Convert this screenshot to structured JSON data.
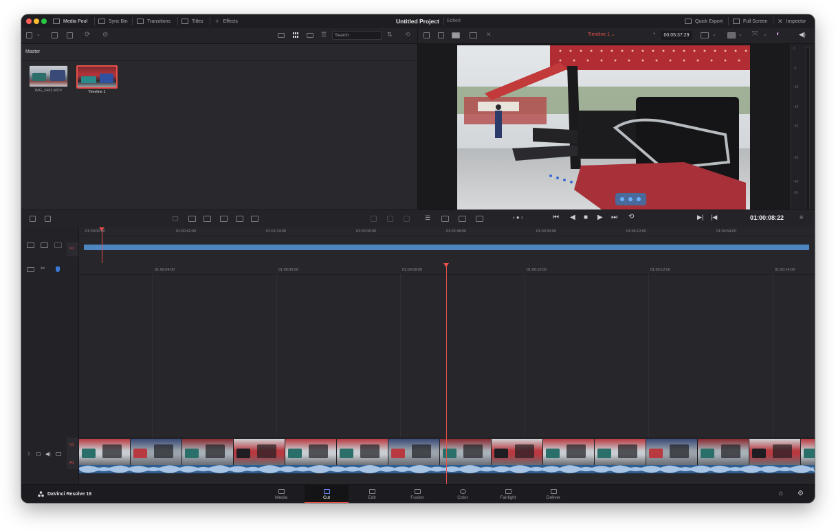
{
  "titlebar": {
    "tabs": [
      {
        "label": "Media Pool",
        "icon": "media-pool-icon"
      },
      {
        "label": "Sync Bin",
        "icon": "sync-bin-icon"
      },
      {
        "label": "Transitions",
        "icon": "transitions-icon"
      },
      {
        "label": "Titles",
        "icon": "titles-icon"
      },
      {
        "label": "Effects",
        "icon": "effects-icon"
      }
    ],
    "project_title": "Untitled Project",
    "project_status": "Edited",
    "right_items": [
      {
        "label": "Quick Export",
        "icon": "quick-export-icon"
      },
      {
        "label": "Full Screen",
        "icon": "full-screen-icon"
      },
      {
        "label": "Inspector",
        "icon": "inspector-icon"
      }
    ]
  },
  "toolbar": {
    "search_placeholder": "Search",
    "timeline_name": "Timeline 1",
    "timeline_duration": "00:05:37:29"
  },
  "media_pool": {
    "bin_name": "Master",
    "items": [
      {
        "name": "IMG_3462.MOV",
        "selected": false
      },
      {
        "name": "Timeline 1",
        "selected": true
      }
    ]
  },
  "viewer": {
    "timecode": "01:00:08:22",
    "meter_labels": [
      "0",
      "-5",
      "-10",
      "-15",
      "-20",
      "-30",
      "-40",
      "-50"
    ]
  },
  "upper_timeline": {
    "track_label": "V1",
    "ruler_labels": [
      "01:00:00:00",
      "01:00:42:00",
      "01:01:24:00",
      "01:02:06:00",
      "01:02:48:00",
      "01:03:30:00",
      "01:04:12:00",
      "01:04:54:00"
    ]
  },
  "lower_timeline": {
    "ruler_labels": [
      "01:00:04:00",
      "01:00:06:00",
      "01:00:08:00",
      "01:00:10:00",
      "01:00:12:00",
      "01:00:14:00"
    ],
    "video_track": "V1",
    "audio_track": "A1"
  },
  "bottom_nav": {
    "app_name": "DaVinci Resolve 19",
    "pages": [
      {
        "label": "Media",
        "icon": "media-page-icon"
      },
      {
        "label": "Cut",
        "icon": "cut-page-icon",
        "active": true
      },
      {
        "label": "Edit",
        "icon": "edit-page-icon"
      },
      {
        "label": "Fusion",
        "icon": "fusion-page-icon"
      },
      {
        "label": "Color",
        "icon": "color-page-icon"
      },
      {
        "label": "Fairlight",
        "icon": "fairlight-page-icon"
      },
      {
        "label": "Deliver",
        "icon": "deliver-page-icon"
      }
    ]
  },
  "colors": {
    "accent": "#e8514a",
    "clip_blue": "#4d86c0",
    "panel": "#28282d"
  }
}
